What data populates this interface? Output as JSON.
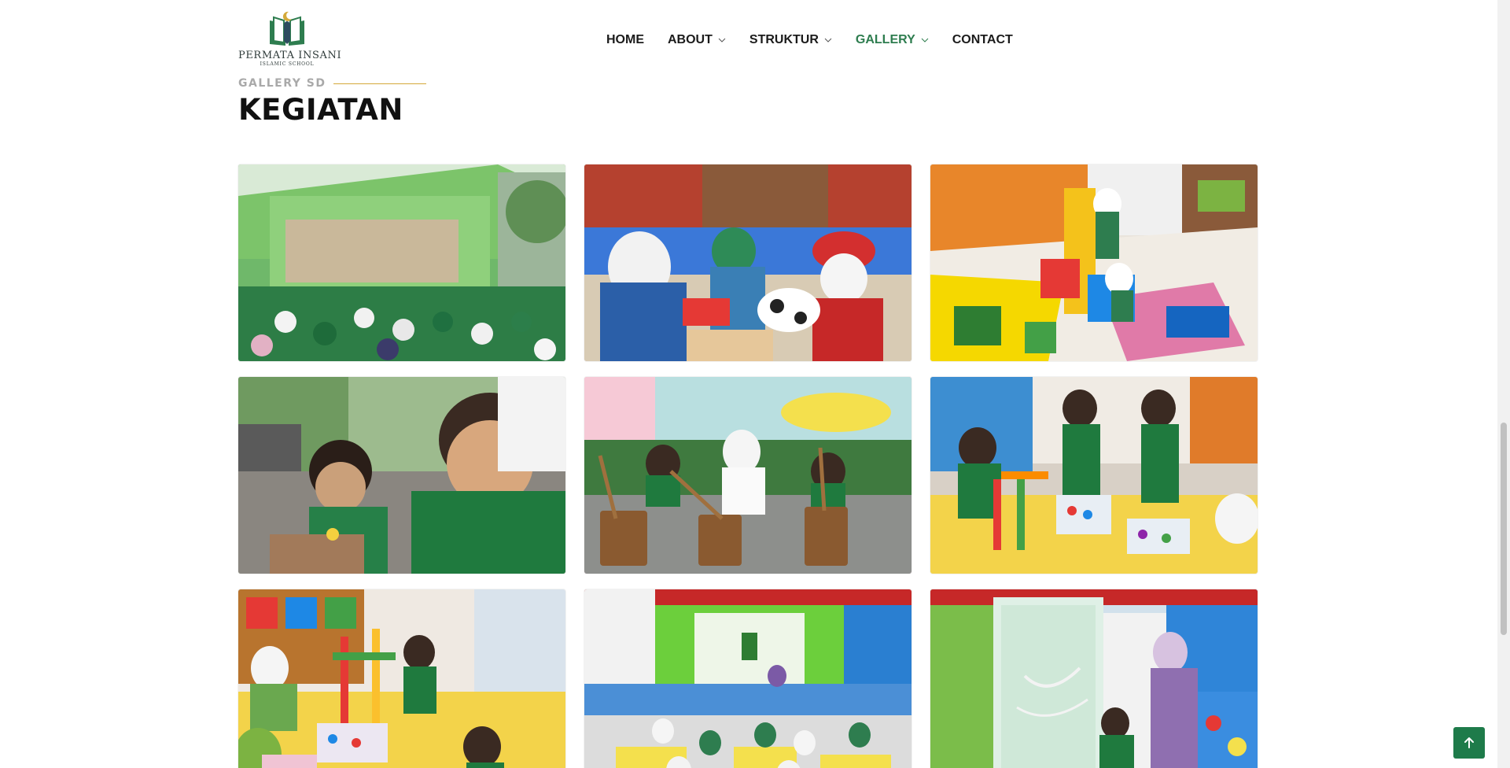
{
  "brand": {
    "name": "PERMATA INSANI",
    "subtitle": "ISLAMIC SCHOOL",
    "primary_color": "#2e7d4f",
    "accent_line_color": "#d4a93a"
  },
  "nav": {
    "items": [
      {
        "label": "HOME",
        "has_dropdown": false,
        "active": false
      },
      {
        "label": "ABOUT",
        "has_dropdown": true,
        "active": false
      },
      {
        "label": "STRUKTUR",
        "has_dropdown": true,
        "active": false
      },
      {
        "label": "GALLERY",
        "has_dropdown": true,
        "active": true
      },
      {
        "label": "CONTACT",
        "has_dropdown": false,
        "active": false
      }
    ]
  },
  "section": {
    "subtitle": "GALLERY SD",
    "title": "KEGIATAN"
  },
  "gallery": {
    "photos": [
      {
        "scene": "school-stage-assembly"
      },
      {
        "scene": "kids-playing-cafe"
      },
      {
        "scene": "kids-building-blocks"
      },
      {
        "scene": "boy-playing-clay"
      },
      {
        "scene": "kids-mortar-pestle"
      },
      {
        "scene": "kids-bead-stacking"
      },
      {
        "scene": "classroom-bead-activity"
      },
      {
        "scene": "classroom-projector-floor"
      },
      {
        "scene": "teacher-smartboard"
      }
    ]
  },
  "back_to_top": {
    "icon": "arrow-up-icon"
  }
}
